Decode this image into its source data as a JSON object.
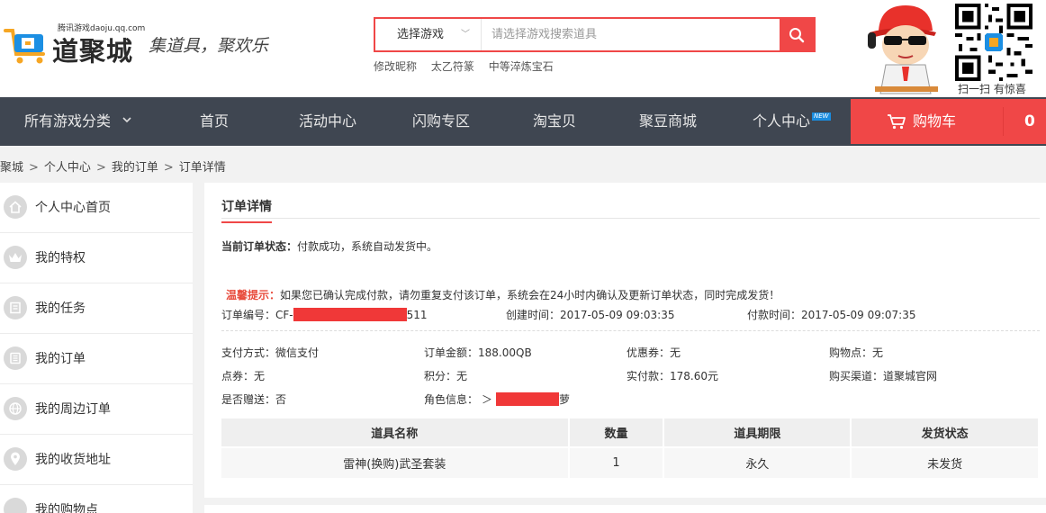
{
  "header": {
    "logo_small": "腾讯游戏daoju.qq.com",
    "logo_text": "道聚城",
    "slogan": "集道具，聚欢乐",
    "search": {
      "select_value": "选择游戏",
      "placeholder": "请选择游戏搜索道具"
    },
    "hot_links": [
      "修改昵称",
      "太乙符篆",
      "中等淬炼宝石"
    ],
    "qr_caption": "扫一扫 有惊喜"
  },
  "nav": {
    "items": [
      {
        "label": "所有游戏分类",
        "icon": "chevron-down-icon"
      },
      {
        "label": "首页"
      },
      {
        "label": "活动中心"
      },
      {
        "label": "闪购专区"
      },
      {
        "label": "淘宝贝"
      },
      {
        "label": "聚豆商城"
      },
      {
        "label": "个人中心",
        "badge": "NEW"
      }
    ],
    "cart_label": "购物车",
    "cart_count": "0"
  },
  "breadcrumb": [
    "聚城",
    "个人中心",
    "我的订单",
    "订单详情"
  ],
  "sidebar": {
    "items": [
      {
        "label": "个人中心首页",
        "icon": "home-icon"
      },
      {
        "label": "我的特权",
        "icon": "crown-icon"
      },
      {
        "label": "我的任务",
        "icon": "task-icon"
      },
      {
        "label": "我的订单",
        "icon": "order-list-icon"
      },
      {
        "label": "我的周边订单",
        "icon": "globe-icon"
      },
      {
        "label": "我的收货地址",
        "icon": "location-pin-icon"
      },
      {
        "label": "我的购物点",
        "icon": "points-icon"
      }
    ]
  },
  "order": {
    "title": "订单详情",
    "status_label": "当前订单状态：",
    "status_value": "付款成功，系统自动发货中。",
    "tip_label": "温馨提示：",
    "tip_text": "如果您已确认完成付款，请勿重复支付该订单，系统会在24小时内确认及更新订单状态，同时完成发货！",
    "order_no_label": "订单编号：",
    "order_no_prefix": "CF-",
    "order_no_suffix": "511",
    "created_label": "创建时间：",
    "created_value": "2017-05-09 09:03:35",
    "paid_label": "付款时间：",
    "paid_value": "2017-05-09 09:07:35",
    "payment_label": "支付方式：",
    "payment_value": "微信支付",
    "amount_label": "订单金额：",
    "amount_value": "188.00QB",
    "coupon_label": "优惠券：",
    "coupon_value": "无",
    "shop_points_label": "购物点：",
    "shop_points_value": "无",
    "voucher_label": "点券：",
    "voucher_value": "无",
    "score_label": "积分：",
    "score_value": "无",
    "actual_label": "实付款：",
    "actual_value": "178.60元",
    "channel_label": "购买渠道：",
    "channel_value": "道聚城官网",
    "gift_label": "是否赠送：",
    "gift_value": "否",
    "role_label": "角色信息：",
    "role_prefix": "＞",
    "role_suffix": "萝",
    "table": {
      "headers": [
        "道具名称",
        "数量",
        "道具期限",
        "发货状态"
      ],
      "rows": [
        [
          "雷神(换购)武圣套装",
          "1",
          "永久",
          "未发货"
        ]
      ]
    }
  },
  "colors": {
    "accent": "#f04747",
    "nav_bg": "#3f4651",
    "page_bg": "#f2f2f2"
  }
}
